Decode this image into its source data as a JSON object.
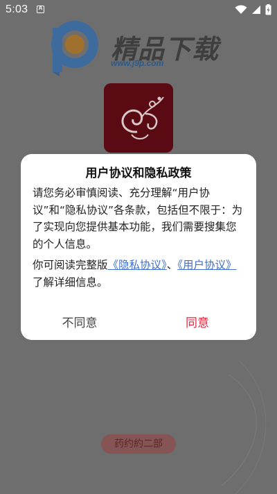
{
  "status_bar": {
    "time": "5:03",
    "notification_letter": "A"
  },
  "watermark": {
    "site_name": "精品下载",
    "site_url": "www.j9p.com"
  },
  "dialog": {
    "title": "用户协议和隐私政策",
    "paragraph1": "请您务必审慎阅读、充分理解“用户协议”和“隐私协议”各条款，包括但不限于：为了实现向您提供基本功能，我们需要搜集您的个人信息。",
    "paragraph2_prefix": "你可阅读完整版",
    "privacy_link": "《隐私协议》",
    "separator": "、",
    "user_agreement_link": "《用户协议》",
    "paragraph2_suffix": "了解详细信息。",
    "disagree_label": "不同意",
    "agree_label": "同意"
  },
  "stamp_text": "药约約二部",
  "colors": {
    "accent_red": "#e8233b",
    "link_blue": "#3d6fd0",
    "icon_background": "#5a0a12"
  }
}
